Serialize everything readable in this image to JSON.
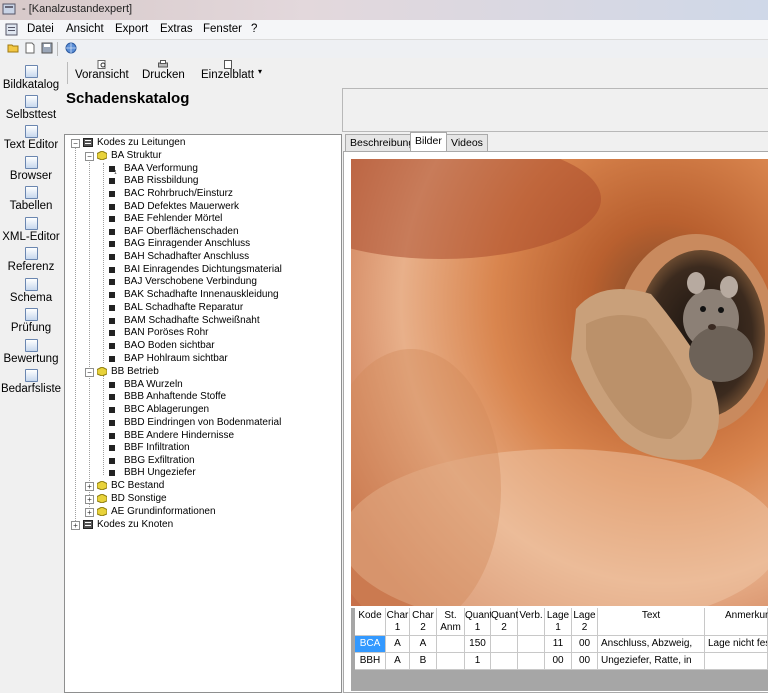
{
  "window": {
    "title": "- [Kanalzustandexpert]"
  },
  "menu": [
    "Datei",
    "Ansicht",
    "Export",
    "Extras",
    "Fenster",
    "?"
  ],
  "quick_toolbar": [
    "open-folder-icon",
    "new-document-icon",
    "save-icon",
    "globe-icon"
  ],
  "sidebar": [
    {
      "label": "Bildkatalog",
      "icon": "picture-icon"
    },
    {
      "label": "Selbsttest",
      "icon": "test-icon"
    },
    {
      "label": "Text Editor",
      "icon": "text-editor-icon"
    },
    {
      "label": "Browser",
      "icon": "browser-icon"
    },
    {
      "label": "Tabellen",
      "icon": "table-icon"
    },
    {
      "label": "XML-Editor",
      "icon": "xml-editor-icon"
    },
    {
      "label": "Referenz",
      "icon": "reference-icon"
    },
    {
      "label": "Schema",
      "icon": "schema-icon"
    },
    {
      "label": "Prüfung",
      "icon": "check-icon"
    },
    {
      "label": "Bewertung",
      "icon": "rating-icon"
    },
    {
      "label": "Bedarfsliste",
      "icon": "list-icon"
    }
  ],
  "toolbar": {
    "preview": "Voransicht",
    "print": "Drucken",
    "single_sheet": "Einzelblatt"
  },
  "heading": "Schadenskatalog",
  "tree": {
    "root1": "Kodes zu Leitungen",
    "ba": "BA Struktur",
    "ba_items": [
      "BAA Verformung",
      "BAB Rissbildung",
      "BAC Rohrbruch/Einsturz",
      "BAD Defektes Mauerwerk",
      "BAE Fehlender Mörtel",
      "BAF Oberflächenschaden",
      "BAG Einragender Anschluss",
      "BAH Schadhafter Anschluss",
      "BAI Einragendes Dichtungsmaterial",
      "BAJ Verschobene Verbindung",
      "BAK Schadhafte Innenauskleidung",
      "BAL Schadhafte Reparatur",
      "BAM Schadhafte Schweißnaht",
      "BAN Poröses Rohr",
      "BAO Boden sichtbar",
      "BAP Hohlraum sichtbar"
    ],
    "bb": "BB Betrieb",
    "bb_items": [
      "BBA Wurzeln",
      "BBB Anhaftende Stoffe",
      "BBC Ablagerungen",
      "BBD Eindringen von Bodenmaterial",
      "BBE Andere Hindernisse",
      "BBF Infiltration",
      "BBG Exfiltration",
      "BBH Ungeziefer"
    ],
    "bc": "BC Bestand",
    "bd": "BD Sonstige",
    "ae": "AE Grundinformationen",
    "root2": "Kodes zu Knoten"
  },
  "tabs": [
    "Beschreibung",
    "Bilder",
    "Videos"
  ],
  "active_tab": "Bilder",
  "grid": {
    "headers": [
      [
        "Kode",
        ""
      ],
      [
        "Char",
        "1"
      ],
      [
        "Char",
        "2"
      ],
      [
        "St.",
        "Anm"
      ],
      [
        "Quant",
        "1"
      ],
      [
        "Quant",
        "2"
      ],
      [
        "Verb.",
        ""
      ],
      [
        "Lage",
        "1"
      ],
      [
        "Lage",
        "2"
      ],
      [
        "Text",
        ""
      ],
      [
        "Anmerkun",
        ""
      ]
    ],
    "rows": [
      [
        "BCA",
        "A",
        "A",
        "",
        "150",
        "",
        "",
        "11",
        "00",
        "Anschluss, Abzweig,",
        "Lage nicht fes"
      ],
      [
        "BBH",
        "A",
        "B",
        "",
        "1",
        "",
        "",
        "00",
        "00",
        "Ungeziefer, Ratte, in",
        ""
      ]
    ]
  }
}
